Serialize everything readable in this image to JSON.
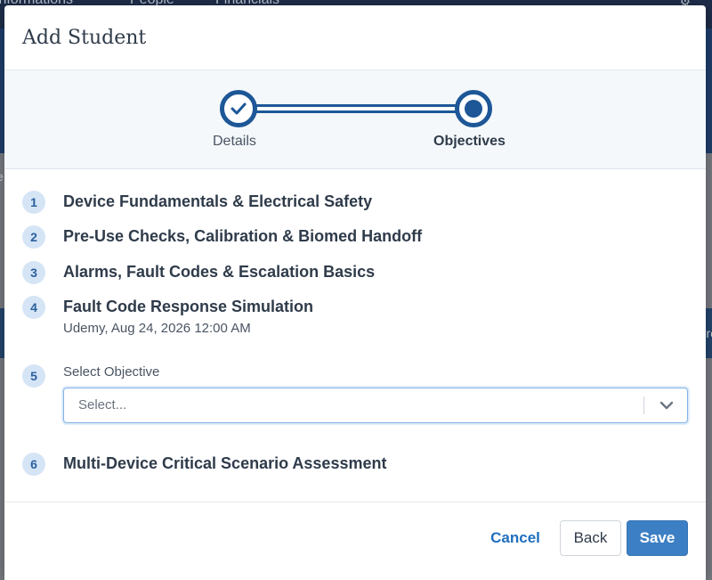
{
  "background": {
    "nav_items": [
      "Informations",
      "People",
      "Financials"
    ],
    "edge_left": "e",
    "edge_right": "ro"
  },
  "modal": {
    "title": "Add Student"
  },
  "stepper": {
    "steps": [
      {
        "label": "Details",
        "state": "complete"
      },
      {
        "label": "Objectives",
        "state": "current"
      }
    ]
  },
  "objectives": [
    {
      "number": "1",
      "title": "Device Fundamentals & Electrical Safety"
    },
    {
      "number": "2",
      "title": "Pre-Use Checks, Calibration & Biomed Handoff"
    },
    {
      "number": "3",
      "title": "Alarms, Fault Codes & Escalation Basics"
    },
    {
      "number": "4",
      "title": "Fault Code Response Simulation",
      "subtitle": "Udemy, Aug 24, 2026 12:00 AM"
    },
    {
      "number": "5",
      "select_label": "Select Objective",
      "select_placeholder": "Select..."
    },
    {
      "number": "6",
      "title": "Multi-Device Critical Scenario Assessment"
    }
  ],
  "footer": {
    "cancel_label": "Cancel",
    "back_label": "Back",
    "save_label": "Save"
  },
  "colors": {
    "accent": "#1d5797",
    "badge_bg": "#d5e5f6",
    "save_bg": "#3d7fc4",
    "link": "#1e6fbf"
  },
  "icons": {
    "step_complete": "check-icon",
    "select": "chevron-down-icon",
    "settings": "gear-icon"
  }
}
